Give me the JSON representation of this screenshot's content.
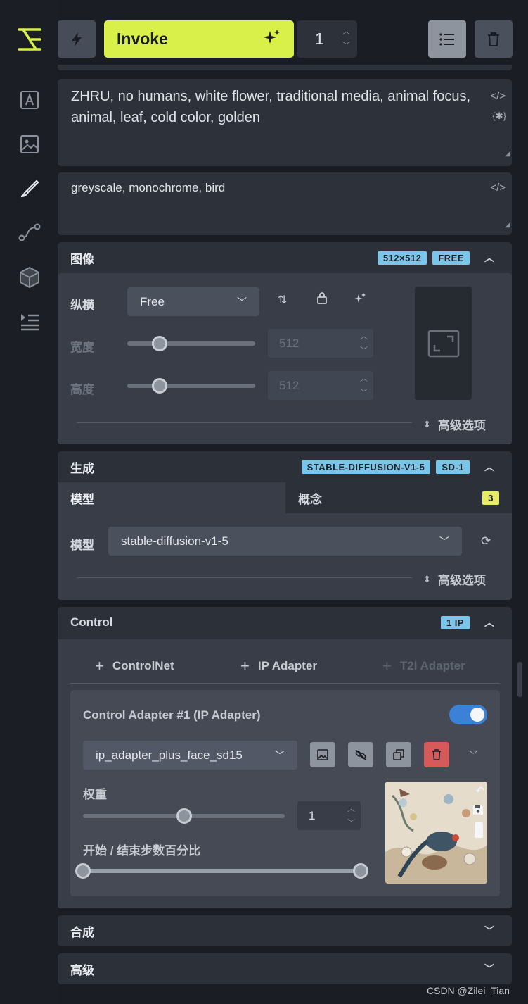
{
  "toolbar": {
    "invoke_label": "Invoke",
    "iterations": "1"
  },
  "prompts": {
    "positive": "ZHRU, no humans, white flower, traditional media, animal focus, animal, leaf, cold color, golden",
    "negative": "greyscale, monochrome, bird"
  },
  "image_section": {
    "title": "图像",
    "size_badge": "512×512",
    "ratio_badge": "FREE",
    "aspect_label": "纵横",
    "aspect_value": "Free",
    "width_label": "宽度",
    "width_value": "512",
    "width_fraction": 0.25,
    "height_label": "高度",
    "height_value": "512",
    "height_fraction": 0.25,
    "advanced_label": "高级选项"
  },
  "generation": {
    "title": "生成",
    "model_badge": "STABLE-DIFFUSION-V1-5",
    "base_badge": "SD-1",
    "tab_model": "模型",
    "tab_concepts": "概念",
    "concepts_count": "3",
    "model_label": "模型",
    "model_value": "stable-diffusion-v1-5",
    "advanced_label": "高级选项"
  },
  "control": {
    "title": "Control",
    "badge": "1 IP",
    "add_controlnet": "ControlNet",
    "add_ip_adapter": "IP Adapter",
    "add_t2i_adapter": "T2I Adapter",
    "adapter_title": "Control Adapter #1 (IP Adapter)",
    "adapter_enabled": true,
    "adapter_model": "ip_adapter_plus_face_sd15",
    "weight_label": "权重",
    "weight_value": "1",
    "weight_fraction": 0.5,
    "step_label": "开始 / 结束步数百分比",
    "step_start": 0,
    "step_end": 1
  },
  "compositing": {
    "title": "合成"
  },
  "advanced": {
    "title": "高级"
  },
  "watermark": "CSDN @Zilei_Tian",
  "colors": {
    "accent": "#d9f04a",
    "badge_blue": "#7ac5ea",
    "toggle_blue": "#3b82d6",
    "delete_red": "#d65a5a"
  }
}
